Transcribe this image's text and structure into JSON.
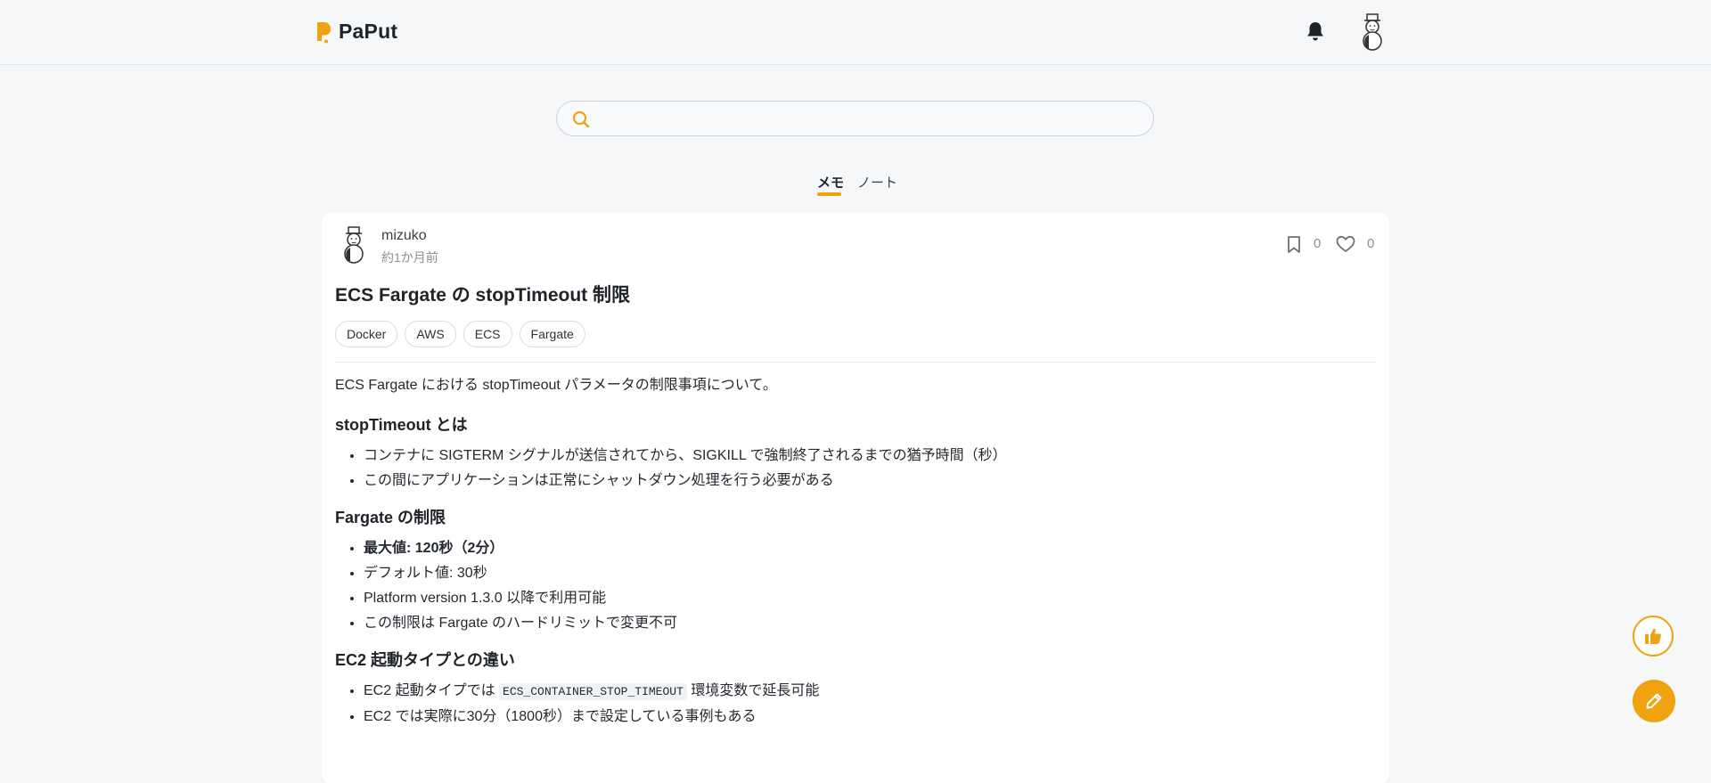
{
  "app": {
    "name": "PaPut",
    "accent": "#f0a20f"
  },
  "header": {
    "bell_icon": "bell-icon",
    "avatar_icon": "snowman-avatar"
  },
  "search": {
    "placeholder": "",
    "value": ""
  },
  "tabs": [
    {
      "label": "メモ",
      "active": true
    },
    {
      "label": "ノート",
      "active": false
    }
  ],
  "memo": {
    "author": "mizuko",
    "posted": "約1か月前",
    "bookmark_count": "0",
    "like_count": "0",
    "title": "ECS Fargate の stopTimeout 制限",
    "tags": [
      "Docker",
      "AWS",
      "ECS",
      "Fargate"
    ],
    "intro": "ECS Fargate における stopTimeout パラメータの制限事項について。",
    "sections": [
      {
        "heading": "stopTimeout とは",
        "items": [
          "コンテナに SIGTERM シグナルが送信されてから、SIGKILL で強制終了されるまでの猶予時間（秒）",
          "この間にアプリケーションは正常にシャットダウン処理を行う必要がある"
        ]
      },
      {
        "heading": "Fargate の制限",
        "items": [
          "最大値: 120秒（2分）",
          "デフォルト値: 30秒",
          "Platform version 1.3.0 以降で利用可能",
          "この制限は Fargate のハードリミットで変更不可"
        ]
      },
      {
        "heading": "EC2 起動タイプとの違い",
        "items": [
          {
            "before": "EC2 起動タイプでは ",
            "code": "ECS_CONTAINER_STOP_TIMEOUT",
            "after": " 環境変数で延長可能"
          },
          "EC2 では実際に30分（1800秒）まで設定している事例もある"
        ]
      }
    ]
  },
  "fabs": {
    "like_icon": "thumbs-up-icon",
    "edit_icon": "pencil-icon"
  }
}
